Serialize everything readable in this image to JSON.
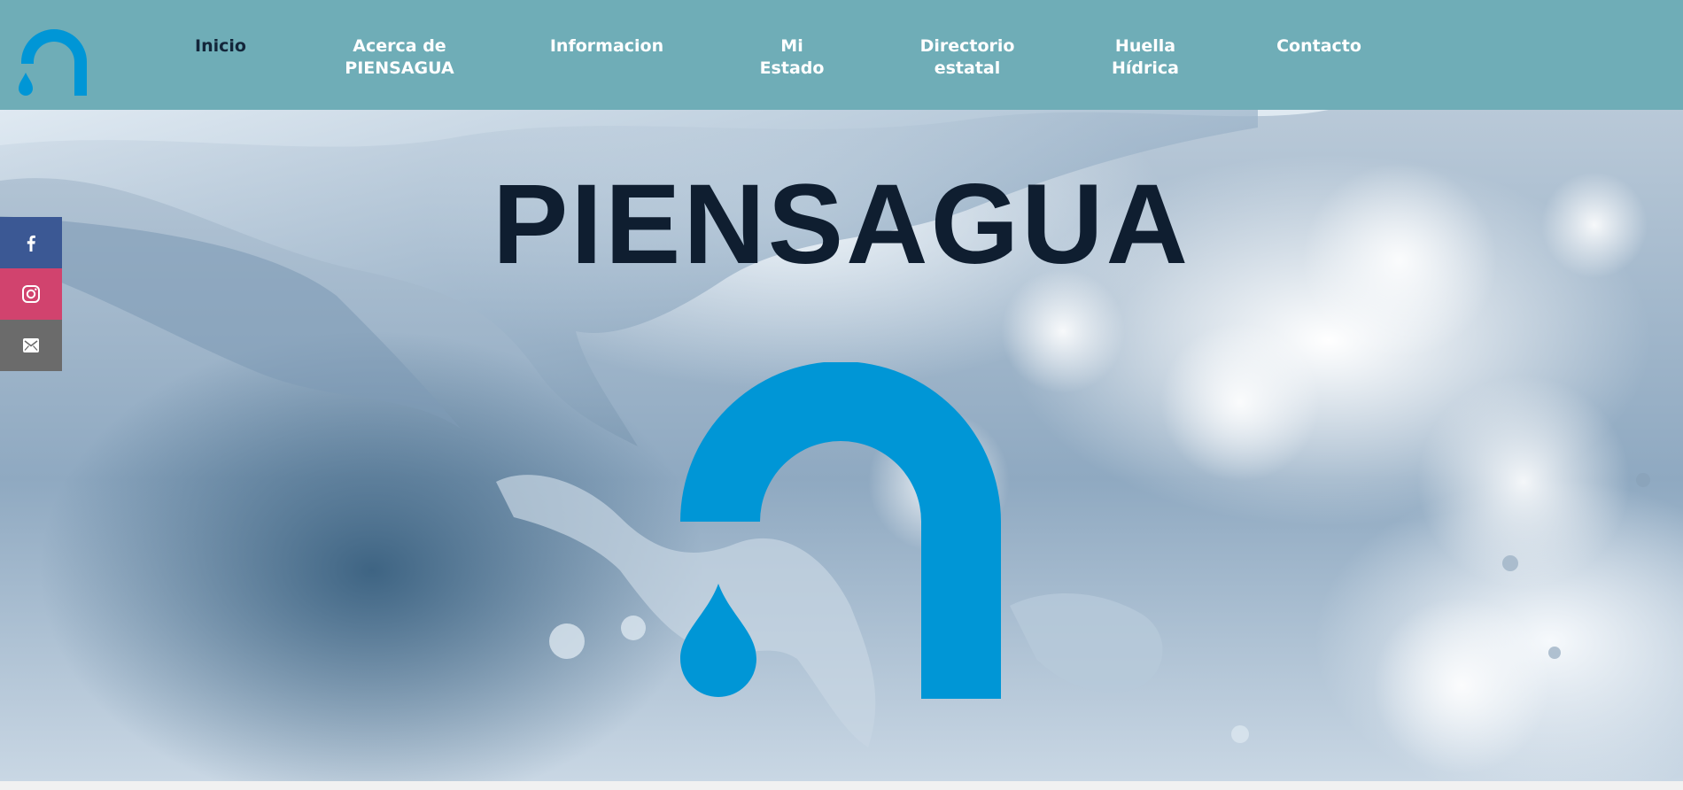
{
  "brand": {
    "primary_color": "#0096d6",
    "header_color": "#6fadb7",
    "active_nav_color": "#13263a"
  },
  "nav": {
    "items": [
      {
        "label": "Inicio",
        "active": true
      },
      {
        "label": "Acerca de\nPIENSAGUA",
        "active": false
      },
      {
        "label": "Informacion",
        "active": false
      },
      {
        "label": "Mi\nEstado",
        "active": false
      },
      {
        "label": "Directorio\nestatal",
        "active": false
      },
      {
        "label": "Huella\nHídrica",
        "active": false
      },
      {
        "label": "Contacto",
        "active": false
      }
    ]
  },
  "hero": {
    "title": "PIENSAGUA",
    "title_color": "#0f1e30"
  },
  "social": {
    "items": [
      {
        "icon": "facebook-icon",
        "color": "#3b5894"
      },
      {
        "icon": "instagram-icon",
        "color": "#d1436e"
      },
      {
        "icon": "mail-icon",
        "color": "#6b6b6b"
      }
    ]
  }
}
